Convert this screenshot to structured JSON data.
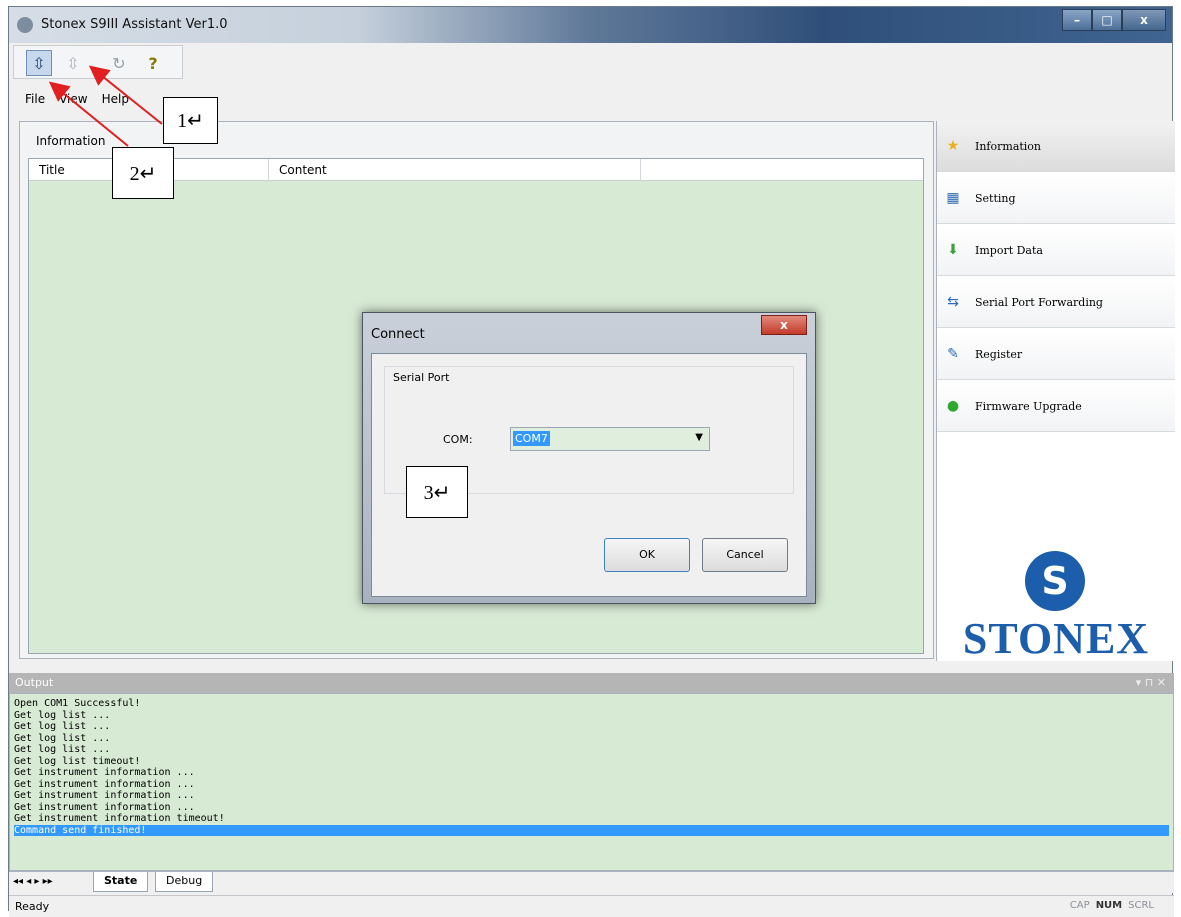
{
  "window": {
    "title": "Stonex S9III Assistant Ver1.0",
    "controls": {
      "minimize": "–",
      "maximize": "□",
      "close": "x"
    }
  },
  "toolbar": {
    "buttons": [
      {
        "icon": "connect-icon",
        "glyph": "⇳",
        "active": true
      },
      {
        "icon": "disconnect-icon",
        "glyph": "⇳",
        "active": false
      },
      {
        "icon": "refresh-icon",
        "glyph": "↻",
        "active": false
      },
      {
        "icon": "help-icon",
        "glyph": "?",
        "active": false
      }
    ]
  },
  "menu": [
    "File",
    "View",
    "Help"
  ],
  "information": {
    "label": "Information",
    "columns": [
      "Title",
      "Content"
    ]
  },
  "sidebar": {
    "items": [
      {
        "label": "Information",
        "icon": "star-icon",
        "glyph": "★",
        "color": "#e8b11c"
      },
      {
        "label": "Setting",
        "icon": "settings-icon",
        "glyph": "▦",
        "color": "#2f6cb5"
      },
      {
        "label": "Import Data",
        "icon": "import-arrow-icon",
        "glyph": "⬇",
        "color": "#3aa33a"
      },
      {
        "label": "Serial Port Forwarding",
        "icon": "serial-port-icon",
        "glyph": "⇆",
        "color": "#2f6cb5"
      },
      {
        "label": "Register",
        "icon": "register-icon",
        "glyph": "✎",
        "color": "#2f6cb5"
      },
      {
        "label": "Firmware Upgrade",
        "icon": "upgrade-icon",
        "glyph": "●",
        "color": "#2ea82e"
      }
    ],
    "logo_text": "STONEX",
    "logo_mark": "S"
  },
  "dialog": {
    "title": "Connect",
    "close": "x",
    "group": "Serial Port",
    "com_label": "COM:",
    "com_value": "COM7",
    "ok": "OK",
    "cancel": "Cancel"
  },
  "callouts": [
    "1↵",
    "2↵",
    "3↵"
  ],
  "output": {
    "title": "Output",
    "tools": "▾ ⊓ ✕",
    "lines": [
      "Open COM1 Successful!",
      "Get log list ...",
      "Get log list ...",
      "Get log list ...",
      "Get log list ...",
      "Get log list timeout!",
      "Get instrument information ...",
      "Get instrument information ...",
      "Get instrument information ...",
      "Get instrument information ...",
      "Get instrument information timeout!",
      "Command send finished!"
    ],
    "highlight_index": 11
  },
  "tabs": {
    "nav": "◂◂ ◂ ▸ ▸▸",
    "items": [
      "State",
      "Debug"
    ],
    "active": "State"
  },
  "status": {
    "text": "Ready",
    "indicators": [
      {
        "label": "CAP",
        "on": false
      },
      {
        "label": "NUM",
        "on": true
      },
      {
        "label": "SCRL",
        "on": false
      }
    ]
  }
}
